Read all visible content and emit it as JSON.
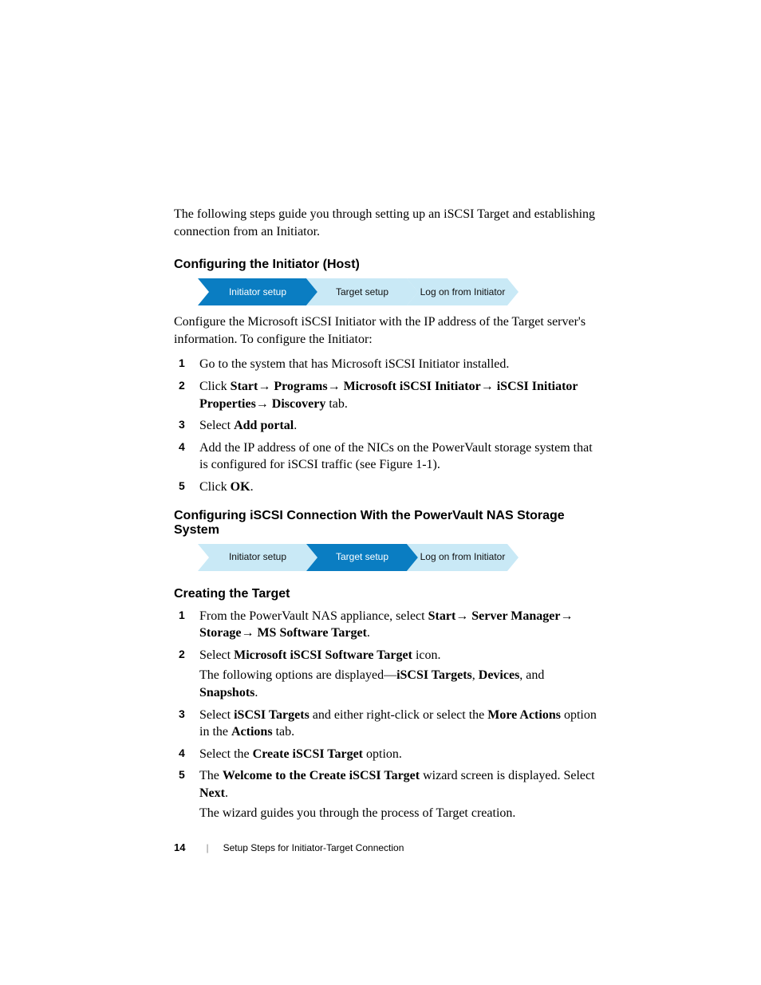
{
  "intro": "The following steps guide you through setting up an iSCSI Target and establishing connection from an Initiator.",
  "section1": {
    "heading": "Configuring the Initiator (Host)",
    "nav": {
      "step1": "Initiator setup",
      "step2": "Target setup",
      "step3": "Log on from Initiator"
    },
    "body": "Configure the Microsoft iSCSI Initiator with the IP address of the Target server's information. To configure the Initiator:",
    "steps": {
      "s1": "Go to the system that has Microsoft iSCSI Initiator installed.",
      "s2_pre": "Click ",
      "s2_b1": "Start",
      "s2_b2": "Programs",
      "s2_b3": "Microsoft iSCSI Initiator",
      "s2_b4": "iSCSI Initiator Properties",
      "s2_b5": "Discovery",
      "s2_post": " tab.",
      "s3_pre": "Select ",
      "s3_b": "Add portal",
      "s3_post": ".",
      "s4": "Add the IP address of one of the NICs on the PowerVault storage system that is configured for iSCSI traffic (see Figure 1-1).",
      "s5_pre": "Click ",
      "s5_b": "OK",
      "s5_post": "."
    }
  },
  "section2": {
    "heading": "Configuring iSCSI Connection With the PowerVault NAS Storage System",
    "nav": {
      "step1": "Initiator setup",
      "step2": "Target setup",
      "step3": "Log on from Initiator"
    }
  },
  "section3": {
    "heading": "Creating the Target",
    "steps": {
      "s1_pre": "From the PowerVault NAS appliance, select ",
      "s1_b1": "Start",
      "s1_b2": "Server Manager",
      "s1_b3": "Storage",
      "s1_b4": "MS Software Target",
      "s1_post": ".",
      "s2_pre": "Select ",
      "s2_b": "Microsoft iSCSI Software Target",
      "s2_post": " icon.",
      "s2_sub_pre": "The following options are displayed—",
      "s2_sub_b1": "iSCSI Targets",
      "s2_sub_mid1": ", ",
      "s2_sub_b2": "Devices",
      "s2_sub_mid2": ", and ",
      "s2_sub_b3": "Snapshots",
      "s2_sub_post": ".",
      "s3_pre": "Select ",
      "s3_b1": "iSCSI Targets",
      "s3_mid1": " and either right-click or select the ",
      "s3_b2": "More Actions",
      "s3_mid2": " option in the ",
      "s3_b3": "Actions",
      "s3_post": " tab.",
      "s4_pre": "Select the ",
      "s4_b": "Create iSCSI Target",
      "s4_post": " option.",
      "s5_pre": "The ",
      "s5_b1": "Welcome to the Create iSCSI Target",
      "s5_mid": " wizard screen is displayed. Select ",
      "s5_b2": "Next",
      "s5_post": ".",
      "s5_sub": "The wizard guides you through the process of Target creation."
    }
  },
  "footer": {
    "page": "14",
    "chapter": "Setup Steps for Initiator-Target Connection"
  },
  "arrow": "→",
  "nums": {
    "n1": "1",
    "n2": "2",
    "n3": "3",
    "n4": "4",
    "n5": "5"
  }
}
